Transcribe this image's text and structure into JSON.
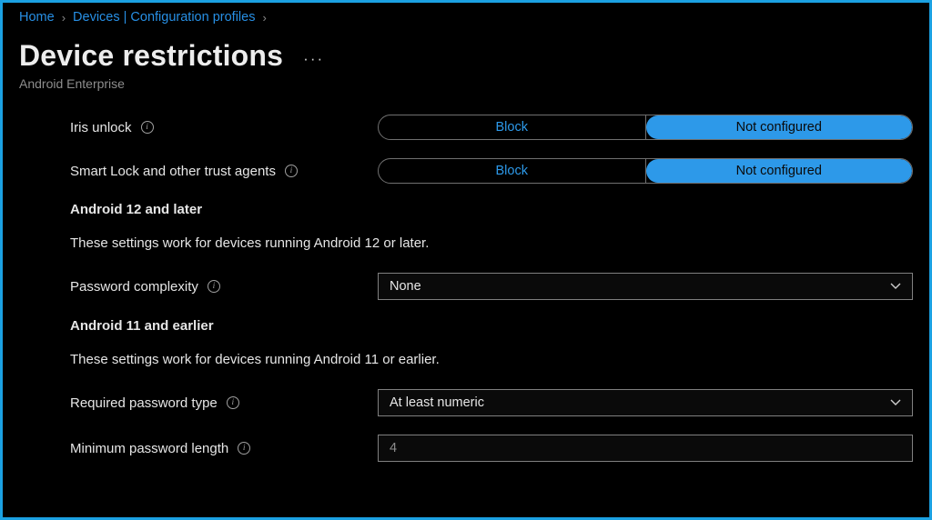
{
  "breadcrumb": {
    "home": "Home",
    "devices": "Devices | Configuration profiles"
  },
  "page_title": "Device restrictions",
  "subtitle": "Android Enterprise",
  "toggle_labels": {
    "block": "Block",
    "not_configured": "Not configured"
  },
  "rows": {
    "iris_unlock": "Iris unlock",
    "smart_lock": "Smart Lock and other trust agents",
    "password_complexity": "Password complexity",
    "required_password_type": "Required password type",
    "min_password_length": "Minimum password length"
  },
  "sections": {
    "android12_heading": "Android 12 and later",
    "android12_desc": "These settings work for devices running Android 12 or later.",
    "android11_heading": "Android 11 and earlier",
    "android11_desc": "These settings work for devices running Android 11 or earlier."
  },
  "dropdowns": {
    "password_complexity_value": "None",
    "required_password_type_value": "At least numeric"
  },
  "inputs": {
    "min_password_length_placeholder": "4"
  }
}
